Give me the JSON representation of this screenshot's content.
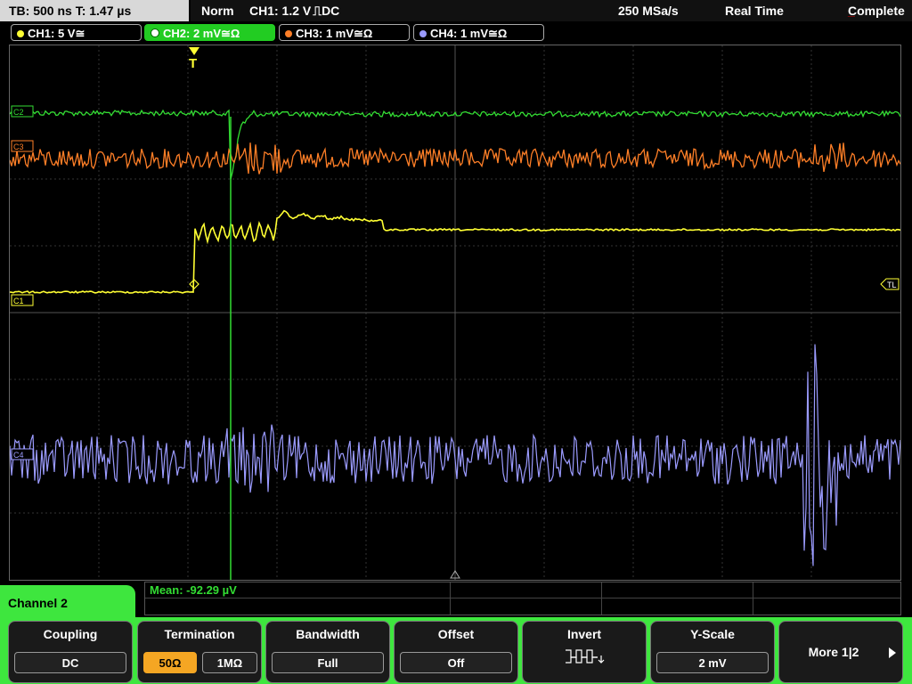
{
  "status": {
    "timebase": "TB: 500 ns   T: 1.47 µs",
    "mode": "Norm",
    "trigger": "CH1: 1.2 V",
    "trigger_suffix": "DC",
    "sample_rate": "250 MSa/s",
    "acq_mode": "Real Time",
    "state": "Complete"
  },
  "channels": [
    {
      "label": "CH1: 5 V",
      "suffix": "≅",
      "color": "#ffff33",
      "active": false
    },
    {
      "label": "CH2: 2 mV",
      "suffix": "≅Ω",
      "color": "#33dd33",
      "active": true
    },
    {
      "label": "CH3: 1 mV",
      "suffix": "≅Ω",
      "color": "#ff7f27",
      "active": false
    },
    {
      "label": "CH4: 1 mV",
      "suffix": "≅Ω",
      "color": "#9b9bff",
      "active": false
    }
  ],
  "markers": {
    "trigger": "T",
    "trigger_level": "TL",
    "ch1": "C1",
    "ch2": "C2",
    "ch3": "C3",
    "ch4": "C4"
  },
  "measurement": {
    "mean": "Mean: -92.29 µV"
  },
  "menu": {
    "title": "Channel 2",
    "coupling": {
      "label": "Coupling",
      "value": "DC"
    },
    "termination": {
      "label": "Termination",
      "opt1": "50Ω",
      "opt2": "1MΩ",
      "selected": "50Ω"
    },
    "bandwidth": {
      "label": "Bandwidth",
      "value": "Full"
    },
    "offset": {
      "label": "Offset",
      "value": "Off"
    },
    "invert": {
      "label": "Invert"
    },
    "yscale": {
      "label": "Y-Scale",
      "value": "2 mV"
    },
    "more": {
      "label": "More 1|2"
    }
  }
}
